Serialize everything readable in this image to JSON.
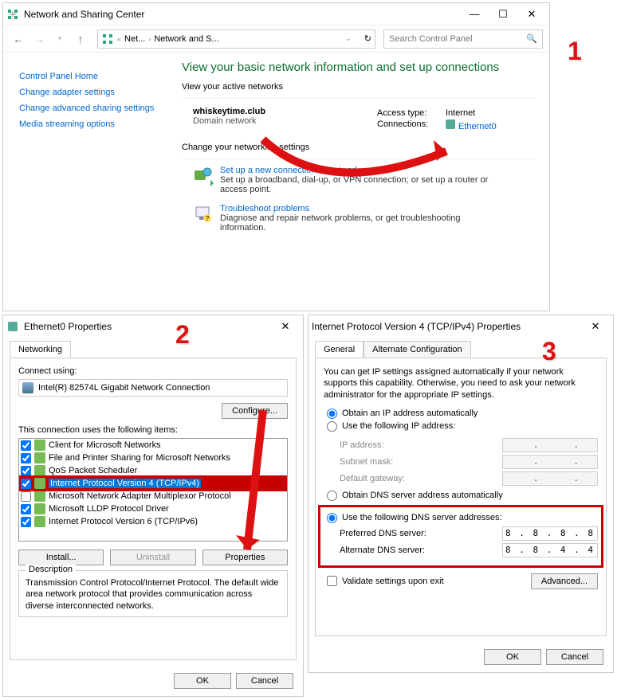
{
  "w1": {
    "title": "Network and Sharing Center",
    "breadcrumb": {
      "p1": "Net...",
      "p2": "Network and S..."
    },
    "search_placeholder": "Search Control Panel",
    "nav": {
      "home": "Control Panel Home",
      "adapters": "Change adapter settings",
      "sharing": "Change advanced sharing settings",
      "media": "Media streaming options"
    },
    "heading": "View your basic network information and set up connections",
    "active_label": "View your active networks",
    "net": {
      "name": "whiskeytime.club",
      "type": "Domain network",
      "access_lbl": "Access type:",
      "access_val": "Internet",
      "conn_lbl": "Connections:",
      "conn_val": "Ethernet0"
    },
    "change_label": "Change your networking settings",
    "setup": {
      "link": "Set up a new connection or network",
      "desc": "Set up a broadband, dial-up, or VPN connection; or set up a router or access point."
    },
    "trouble": {
      "link": "Troubleshoot problems",
      "desc": "Diagnose and repair network problems, or get troubleshooting information."
    }
  },
  "w2": {
    "title": "Ethernet0 Properties",
    "tab": "Networking",
    "connect_lbl": "Connect using:",
    "adapter": "Intel(R) 82574L Gigabit Network Connection",
    "configure": "Configure...",
    "items_lbl": "This connection uses the following items:",
    "items": [
      {
        "checked": true,
        "label": "Client for Microsoft Networks"
      },
      {
        "checked": true,
        "label": "File and Printer Sharing for Microsoft Networks"
      },
      {
        "checked": true,
        "label": "QoS Packet Scheduler"
      },
      {
        "checked": true,
        "label": "Internet Protocol Version 4 (TCP/IPv4)",
        "selected": true
      },
      {
        "checked": false,
        "label": "Microsoft Network Adapter Multiplexor Protocol"
      },
      {
        "checked": true,
        "label": "Microsoft LLDP Protocol Driver"
      },
      {
        "checked": true,
        "label": "Internet Protocol Version 6 (TCP/IPv6)"
      }
    ],
    "install": "Install...",
    "uninstall": "Uninstall",
    "properties": "Properties",
    "desc_lbl": "Description",
    "desc": "Transmission Control Protocol/Internet Protocol. The default wide area network protocol that provides communication across diverse interconnected networks.",
    "ok": "OK",
    "cancel": "Cancel"
  },
  "w3": {
    "title": "Internet Protocol Version 4 (TCP/IPv4) Properties",
    "tab_general": "General",
    "tab_alt": "Alternate Configuration",
    "help": "You can get IP settings assigned automatically if your network supports this capability. Otherwise, you need to ask your network administrator for the appropriate IP settings.",
    "ip_auto": "Obtain an IP address automatically",
    "ip_manual": "Use the following IP address:",
    "ip_lbl": "IP address:",
    "mask_lbl": "Subnet mask:",
    "gw_lbl": "Default gateway:",
    "dns_auto": "Obtain DNS server address automatically",
    "dns_manual": "Use the following DNS server addresses:",
    "pdns_lbl": "Preferred DNS server:",
    "adns_lbl": "Alternate DNS server:",
    "pdns_val": "8 . 8 . 8 . 8",
    "adns_val": "8 . 8 . 4 . 4",
    "validate": "Validate settings upon exit",
    "advanced": "Advanced...",
    "ok": "OK",
    "cancel": "Cancel"
  },
  "annot": {
    "n1": "1",
    "n2": "2",
    "n3": "3"
  }
}
